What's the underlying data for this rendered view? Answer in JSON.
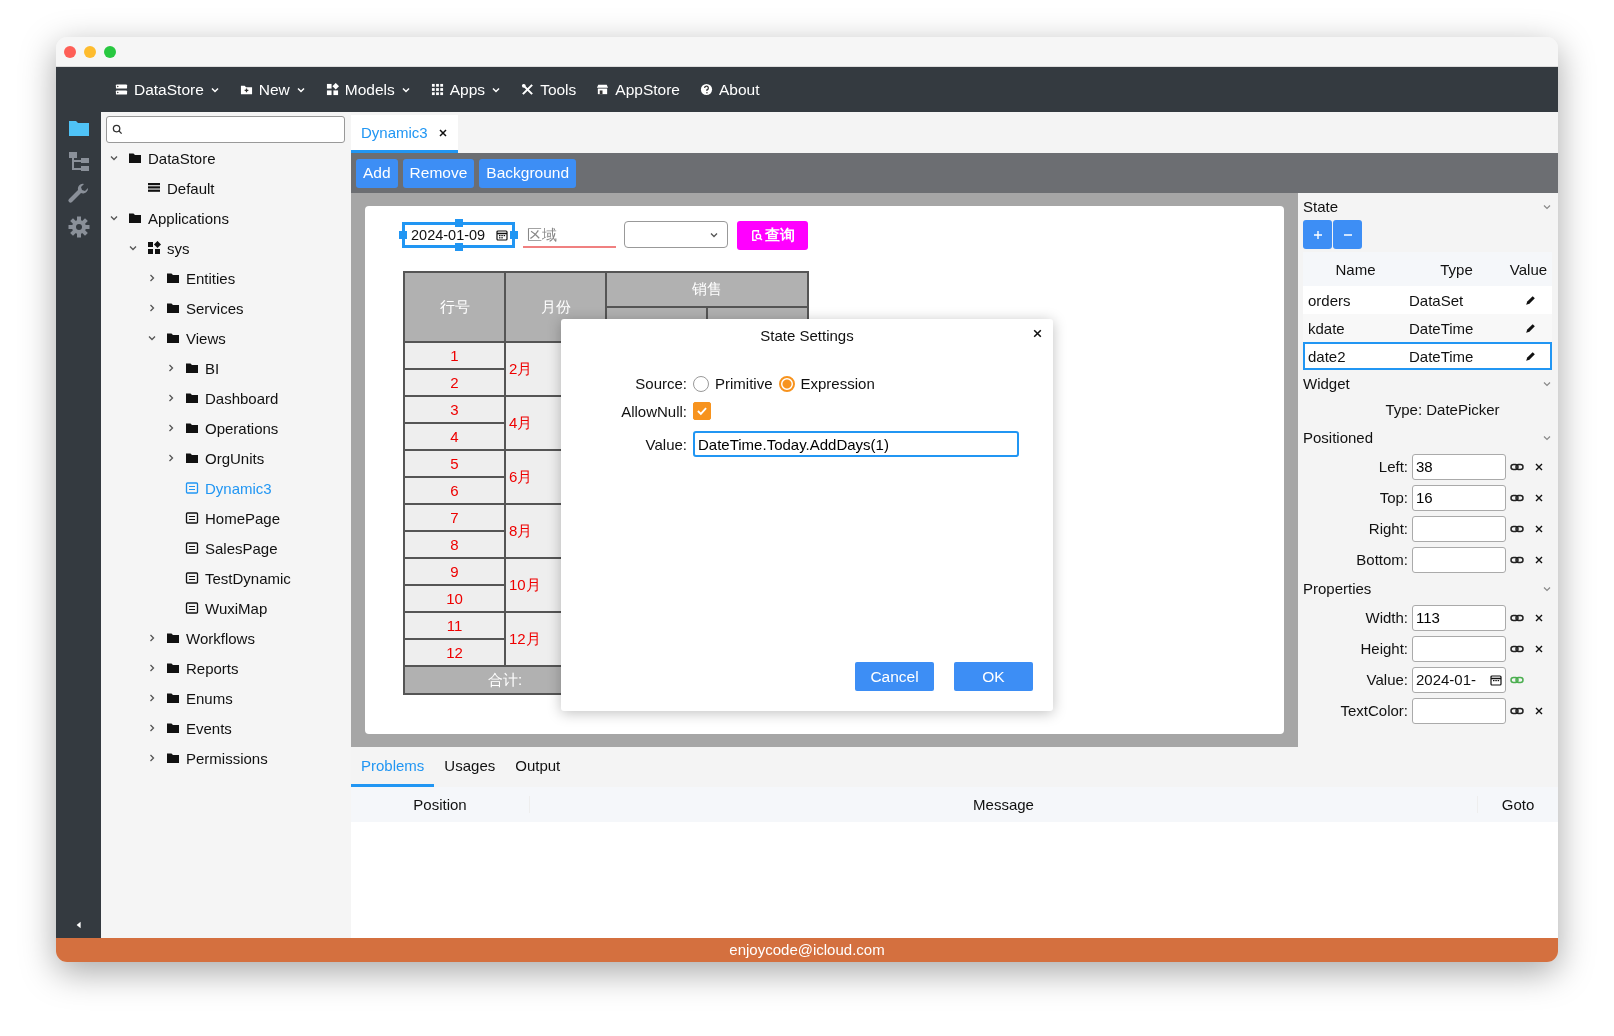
{
  "top_menu": [
    {
      "label": "DataStore",
      "kind": "server",
      "dropdown": true
    },
    {
      "label": "New",
      "kind": "folder-plus",
      "dropdown": true
    },
    {
      "label": "Models",
      "kind": "blocks",
      "dropdown": true
    },
    {
      "label": "Apps",
      "kind": "grid",
      "dropdown": true
    },
    {
      "label": "Tools",
      "kind": "tools",
      "dropdown": false
    },
    {
      "label": "AppStore",
      "kind": "store",
      "dropdown": false
    },
    {
      "label": "About",
      "kind": "help",
      "dropdown": false
    }
  ],
  "activity_bar": [
    {
      "kind": "folder",
      "selected": true
    },
    {
      "kind": "hierarchy",
      "selected": false
    },
    {
      "kind": "wrench",
      "selected": false
    },
    {
      "kind": "gear",
      "selected": false
    }
  ],
  "tree": [
    {
      "label": "DataStore",
      "kind": "folder",
      "expanded": true,
      "selected": false,
      "children": [
        {
          "label": "Default",
          "kind": "table",
          "selected": false
        }
      ]
    },
    {
      "label": "Applications",
      "kind": "folder",
      "expanded": true,
      "selected": false,
      "children": [
        {
          "label": "sys",
          "kind": "app",
          "expanded": true,
          "selected": false,
          "children": [
            {
              "label": "Entities",
              "kind": "folder",
              "expanded": false,
              "selected": false
            },
            {
              "label": "Services",
              "kind": "folder",
              "expanded": false,
              "selected": false
            },
            {
              "label": "Views",
              "kind": "folder",
              "expanded": true,
              "selected": false,
              "children": [
                {
                  "label": "BI",
                  "kind": "folder",
                  "expanded": false,
                  "selected": false
                },
                {
                  "label": "Dashboard",
                  "kind": "folder",
                  "expanded": false,
                  "selected": false
                },
                {
                  "label": "Operations",
                  "kind": "folder",
                  "expanded": false,
                  "selected": false
                },
                {
                  "label": "OrgUnits",
                  "kind": "folder",
                  "expanded": false,
                  "selected": false
                },
                {
                  "label": "Dynamic3",
                  "kind": "view",
                  "selected": true
                },
                {
                  "label": "HomePage",
                  "kind": "view",
                  "selected": false
                },
                {
                  "label": "SalesPage",
                  "kind": "view",
                  "selected": false
                },
                {
                  "label": "TestDynamic",
                  "kind": "view",
                  "selected": false
                },
                {
                  "label": "WuxiMap",
                  "kind": "view",
                  "selected": false
                }
              ]
            },
            {
              "label": "Workflows",
              "kind": "folder",
              "expanded": false,
              "selected": false
            },
            {
              "label": "Reports",
              "kind": "folder",
              "expanded": false,
              "selected": false
            },
            {
              "label": "Enums",
              "kind": "folder",
              "expanded": false,
              "selected": false
            },
            {
              "label": "Events",
              "kind": "folder",
              "expanded": false,
              "selected": false
            },
            {
              "label": "Permissions",
              "kind": "folder",
              "expanded": false,
              "selected": false
            }
          ]
        }
      ]
    }
  ],
  "tabs": [
    {
      "label": "Dynamic3",
      "selected": true
    }
  ],
  "toolbar": [
    "Add",
    "Remove",
    "Background"
  ],
  "canvas": {
    "date_picker": {
      "value": "2024-01-09",
      "selected": true
    },
    "region_field": {
      "placeholder": "区域"
    },
    "query_button": "查询",
    "table": {
      "row_no_header": "行号",
      "month_header": "月份",
      "sales_header": "销售",
      "groups": [
        {
          "month": "2月",
          "rows": [
            "1",
            "2"
          ]
        },
        {
          "month": "4月",
          "rows": [
            "3",
            "4"
          ]
        },
        {
          "month": "6月",
          "rows": [
            "5",
            "6"
          ]
        },
        {
          "month": "8月",
          "rows": [
            "7",
            "8"
          ]
        },
        {
          "month": "10月",
          "rows": [
            "9",
            "10"
          ]
        },
        {
          "month": "12月",
          "rows": [
            "11",
            "12"
          ]
        }
      ],
      "footer": "合计:"
    }
  },
  "dialog": {
    "title": "State Settings",
    "source_label": "Source:",
    "source_options": [
      {
        "label": "Primitive",
        "selected": false
      },
      {
        "label": "Expression",
        "selected": true
      }
    ],
    "allow_null_label": "AllowNull:",
    "allow_null_checked": true,
    "value_label": "Value:",
    "value": "DateTime.Today.AddDays(1)",
    "buttons": [
      "Cancel",
      "OK"
    ]
  },
  "right_panel": {
    "state": {
      "title": "State",
      "columns": [
        "Name",
        "Type",
        "Value"
      ],
      "rows": [
        {
          "name": "orders",
          "type": "DataSet",
          "selected": false
        },
        {
          "name": "kdate",
          "type": "DateTime",
          "selected": false
        },
        {
          "name": "date2",
          "type": "DateTime",
          "selected": true
        }
      ]
    },
    "widget": {
      "title": "Widget",
      "type_text": "Type: DatePicker"
    },
    "positioned": {
      "title": "Positioned",
      "fields": [
        {
          "label": "Left:",
          "value": "38",
          "kind": "text",
          "bound": false
        },
        {
          "label": "Top:",
          "value": "16",
          "kind": "text",
          "bound": false
        },
        {
          "label": "Right:",
          "kind": "text",
          "bound": false
        },
        {
          "label": "Bottom:",
          "kind": "text",
          "bound": false
        }
      ]
    },
    "properties": {
      "title": "Properties",
      "fields": [
        {
          "label": "Width:",
          "value": "113",
          "kind": "text",
          "bound": false
        },
        {
          "label": "Height:",
          "kind": "text",
          "bound": false
        },
        {
          "label": "Value:",
          "value": "2024-01-",
          "kind": "date",
          "bound": true
        },
        {
          "label": "TextColor:",
          "kind": "text",
          "bound": false
        }
      ]
    }
  },
  "bottom_panel": {
    "tabs": [
      {
        "label": "Problems",
        "selected": true
      },
      {
        "label": "Usages",
        "selected": false
      },
      {
        "label": "Output",
        "selected": false
      }
    ],
    "columns": [
      "Position",
      "Message",
      "Goto"
    ]
  },
  "footer": "enjoycode@icloud.com"
}
